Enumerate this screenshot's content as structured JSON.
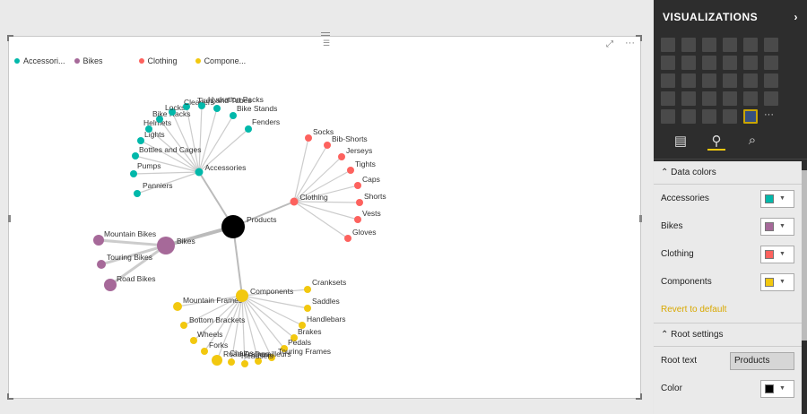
{
  "legend": [
    {
      "label": "Accessori...",
      "color": "#01b8aa"
    },
    {
      "label": "Bikes",
      "color": "#a66999"
    },
    {
      "label": "Clothing",
      "color": "#fd625e"
    },
    {
      "label": "Compone...",
      "color": "#f2c80f"
    }
  ],
  "graph": {
    "root": "Products",
    "root_color": "#000000",
    "groups": [
      {
        "name": "Accessories",
        "color": "#01b8aa",
        "children": [
          "Panniers",
          "Pumps",
          "Bottles and Cages",
          "Lights",
          "Helmets",
          "Bike Racks",
          "Locks",
          "Cleaners",
          "Tires and Tubes",
          "Hydration Packs",
          "Bike Stands",
          "Fenders"
        ]
      },
      {
        "name": "Clothing",
        "color": "#fd625e",
        "children": [
          "Socks",
          "Bib-Shorts",
          "Jerseys",
          "Tights",
          "Caps",
          "Shorts",
          "Vests",
          "Gloves"
        ]
      },
      {
        "name": "Bikes",
        "color": "#a66999",
        "children": [
          "Mountain Bikes",
          "Touring Bikes",
          "Road Bikes"
        ]
      },
      {
        "name": "Components",
        "color": "#f2c80f",
        "children": [
          "Cranksets",
          "Saddles",
          "Handlebars",
          "Brakes",
          "Pedals",
          "Touring Frames",
          "Derailleurs",
          "Headsets",
          "Chains",
          "Road Frames",
          "Forks",
          "Wheels",
          "Bottom Brackets",
          "Mountain Frames"
        ]
      }
    ]
  },
  "panel": {
    "title": "VISUALIZATIONS",
    "more": "···",
    "data_colors": {
      "header": "Data colors",
      "items": [
        {
          "label": "Accessories",
          "color": "#01b8aa"
        },
        {
          "label": "Bikes",
          "color": "#a66999"
        },
        {
          "label": "Clothing",
          "color": "#fd625e"
        },
        {
          "label": "Components",
          "color": "#f2c80f"
        }
      ],
      "revert": "Revert to default"
    },
    "root_settings": {
      "header": "Root settings",
      "root_text_label": "Root text",
      "root_text_value": "Products",
      "color_label": "Color",
      "color": "#000000"
    }
  }
}
